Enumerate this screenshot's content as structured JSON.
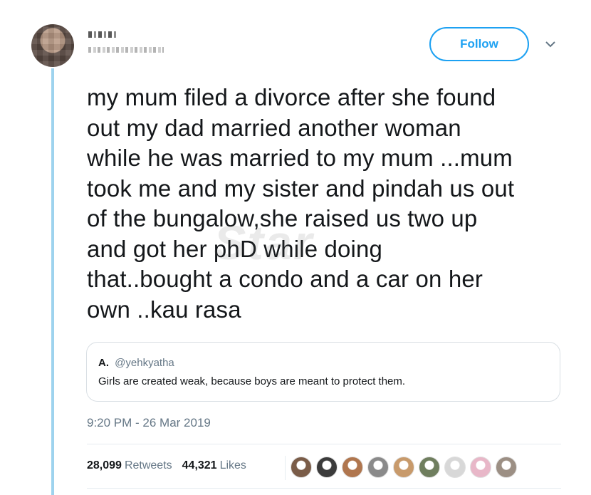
{
  "tweet": {
    "follow_label": "Follow",
    "text": "my mum filed a divorce after she found\nout my dad married another woman\nwhile he was married to my mum ...mum\ntook me and my sister and pindah us out\nof the bungalow,she raised us two up\nand got her phD while doing\nthat..bought a condo and a car on her\nown ..kau rasa",
    "watermark": "Star",
    "quote": {
      "name": "A.",
      "handle": "@yehkyatha",
      "text": "Girls are created weak, because boys are meant to protect them."
    },
    "timestamp": "9:20 PM - 26 Mar 2019",
    "stats": {
      "retweets_count": "28,099",
      "retweets_label": "Retweets",
      "likes_count": "44,321",
      "likes_label": "Likes"
    }
  },
  "colors": {
    "accent": "#1da1f2",
    "thread_line": "#9ed3ee",
    "secondary_text": "#657786"
  },
  "liker_avatars": [
    {
      "color": "#7a5c48"
    },
    {
      "color": "#3b3b3b"
    },
    {
      "color": "#b0764e"
    },
    {
      "color": "#8a8a8a"
    },
    {
      "color": "#c89a6b"
    },
    {
      "color": "#6f7e5e"
    },
    {
      "color": "#d8d8d8"
    },
    {
      "color": "#e8b7c8"
    },
    {
      "color": "#9c8f84"
    }
  ]
}
